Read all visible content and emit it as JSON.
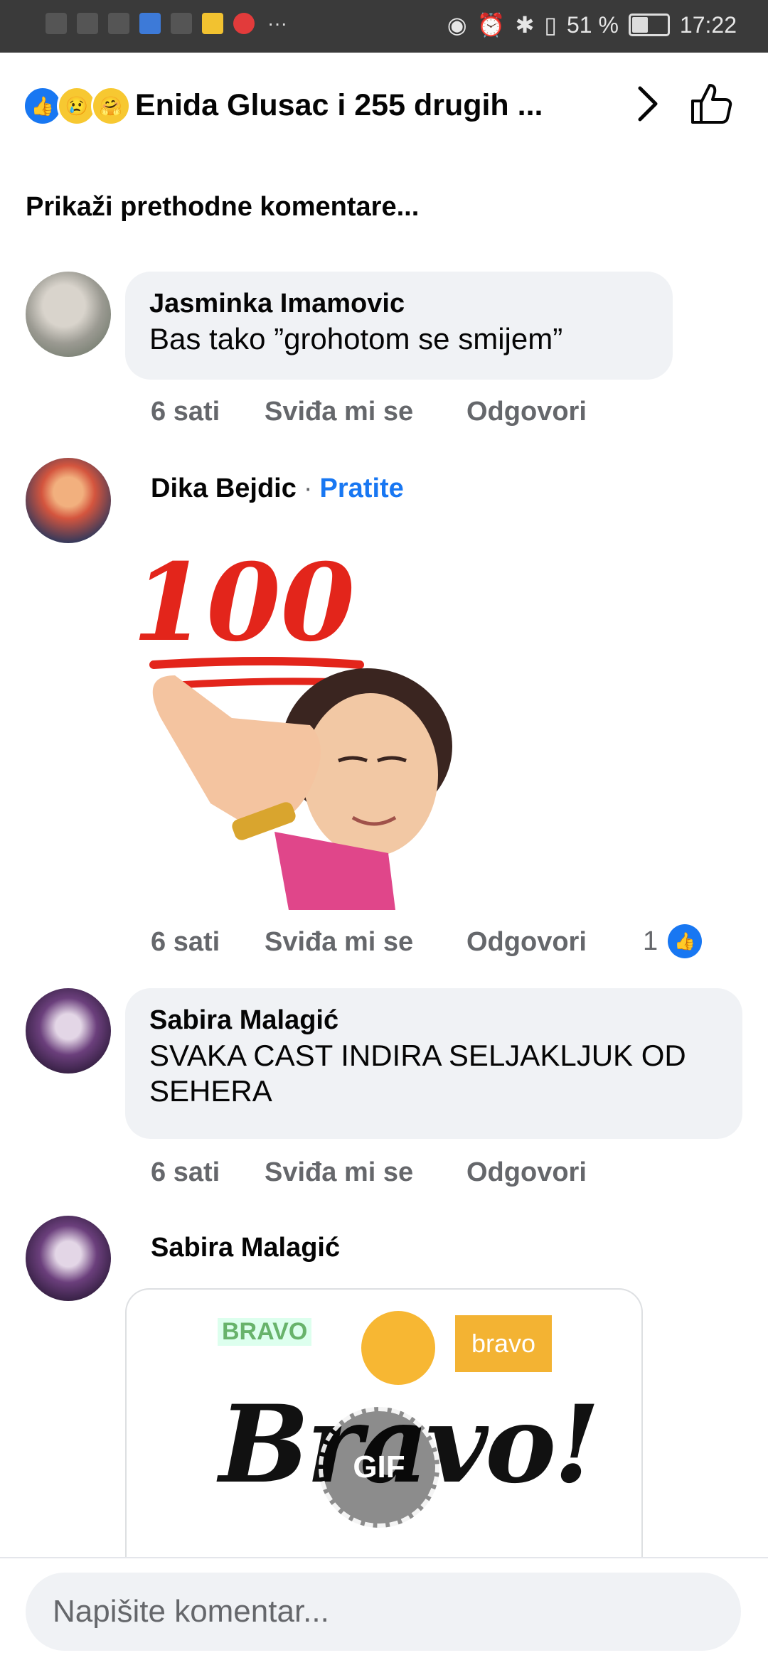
{
  "status_bar": {
    "battery": "51 %",
    "battery_level": 0.51,
    "time": "17:22",
    "more": "···"
  },
  "header": {
    "title": "Enida Glusac i 255 drugih ...",
    "reactions": [
      "like-icon",
      "sad-icon",
      "care-icon"
    ]
  },
  "prev_comments": "Prikaži prethodne komentare...",
  "comments": [
    {
      "author": "Jasminka Imamovic",
      "text": "Bas tako ”grohotom se smijem”",
      "time": "6 sati",
      "like": "Sviđa mi se",
      "reply": "Odgovori"
    },
    {
      "author": "Dika Bejdic",
      "separator": "·",
      "follow": "Pratite",
      "sticker": "100",
      "time": "6 sati",
      "like": "Sviđa mi se",
      "reply": "Odgovori",
      "like_count": "1"
    },
    {
      "author": "Sabira Malagić",
      "text": "SVAKA CAST INDIRA SELJAKLJUK OD SEHERA",
      "time": "6 sati",
      "like": "Sviđa mi se",
      "reply": "Odgovori"
    },
    {
      "author": "Sabira Malagić",
      "gif": {
        "small_label": "BRAVO",
        "box_label": "bravo",
        "big_label": "Bravo!",
        "badge": "GIF"
      }
    }
  ],
  "composer": {
    "placeholder": "Napišite komentar..."
  },
  "colors": {
    "accent": "#1877f2",
    "bubble": "#f0f2f5",
    "meta": "#65676b",
    "status_bar": "#3a3a3a"
  }
}
